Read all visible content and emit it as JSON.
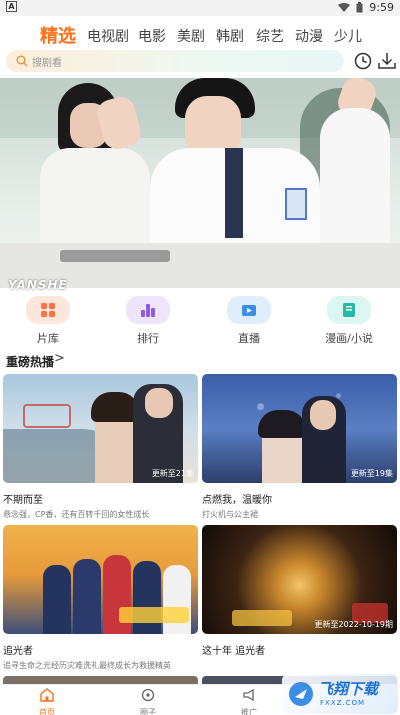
{
  "status_bar": {
    "time": "9:59",
    "left_icon": "A"
  },
  "tabs": [
    {
      "label": "精选",
      "active": true
    },
    {
      "label": "电视剧",
      "active": false
    },
    {
      "label": "电影",
      "active": false
    },
    {
      "label": "美剧",
      "active": false
    },
    {
      "label": "韩剧",
      "active": false
    },
    {
      "label": "综艺",
      "active": false
    },
    {
      "label": "动漫",
      "active": false
    },
    {
      "label": "少儿",
      "active": false
    }
  ],
  "search": {
    "placeholder": "搜剧看"
  },
  "banner": {
    "caption": "YANSHE"
  },
  "quick_nav": [
    {
      "label": "片库",
      "icon": "grid-icon",
      "color": "#ff7043"
    },
    {
      "label": "排行",
      "icon": "bar-chart-icon",
      "color": "#8e5ce0"
    },
    {
      "label": "直播",
      "icon": "live-tv-icon",
      "color": "#3b8fe8"
    },
    {
      "label": "漫画/小说",
      "icon": "book-icon",
      "color": "#27b9a6"
    }
  ],
  "section": {
    "title": "重磅热播",
    "arrow": ">"
  },
  "cards": [
    {
      "title": "不期而至",
      "desc": "悬念强，CP香，还有百转千回的女性成长",
      "update": "更新至21集"
    },
    {
      "title": "点燃我，温暖你",
      "desc": "打火机与公主裙",
      "update": "更新至19集"
    },
    {
      "title": "追光者",
      "desc": "追寻生命之光经历灾难洗礼最终成长为救援精英",
      "update": ""
    },
    {
      "title": "这十年 追光者",
      "desc": "",
      "update": "更新至2022-10-19期"
    }
  ],
  "bottom_nav": [
    {
      "label": "首页",
      "icon": "home-icon",
      "active": true
    },
    {
      "label": "圈子",
      "icon": "circle-icon",
      "active": false
    },
    {
      "label": "推广",
      "icon": "megaphone-icon",
      "active": false
    }
  ],
  "watermark": {
    "text": "飞翔下载",
    "sub": "FXXZ.COM"
  }
}
